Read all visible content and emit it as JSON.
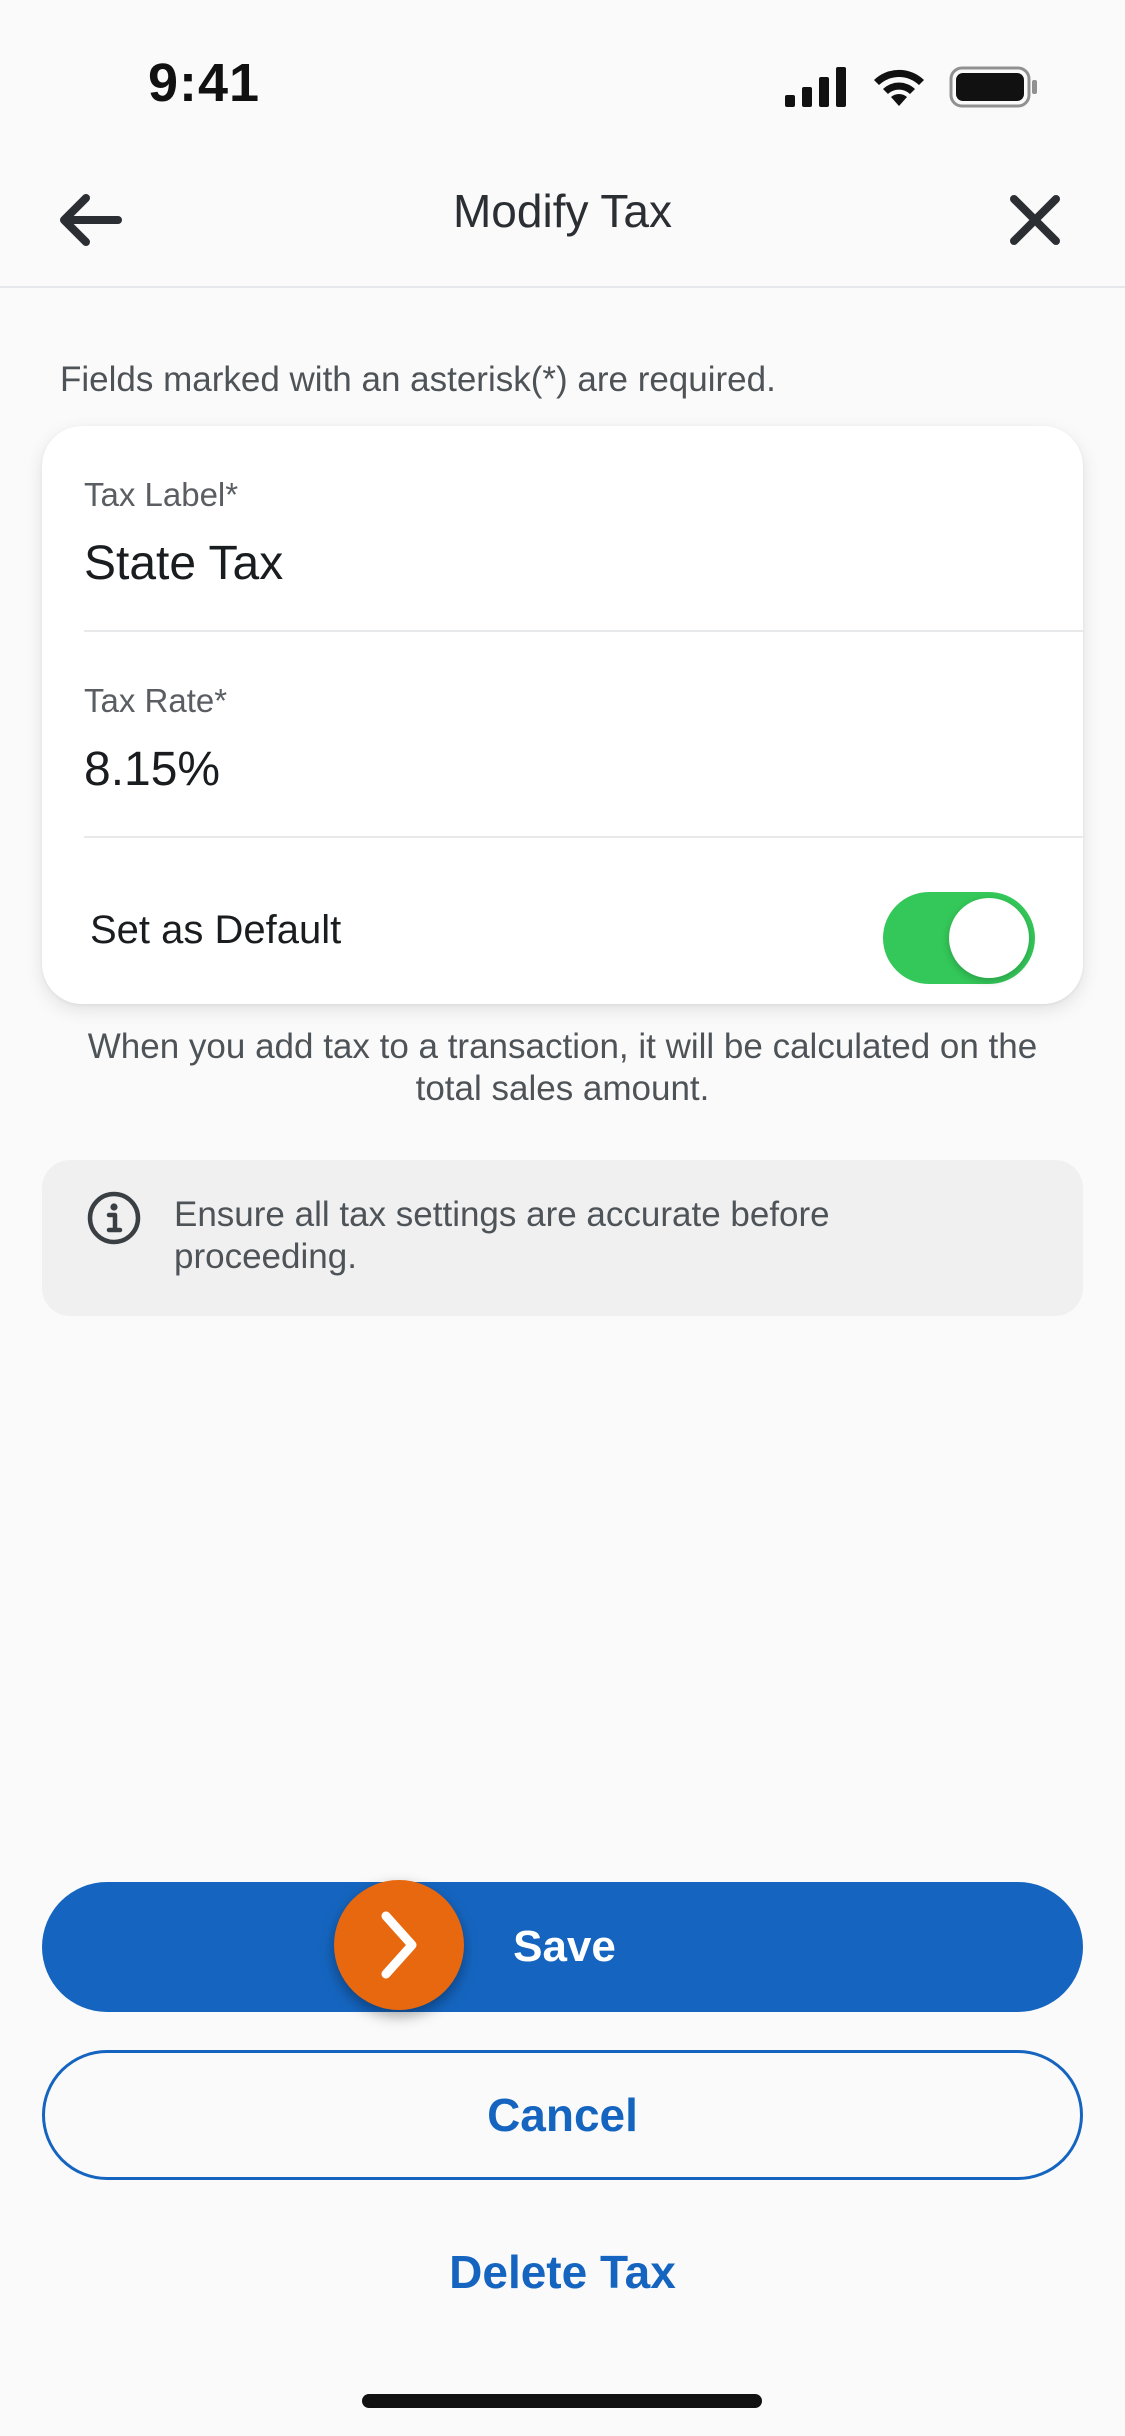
{
  "status_bar": {
    "time": "9:41"
  },
  "header": {
    "title": "Modify Tax",
    "back_icon": "arrow-left-icon",
    "close_icon": "close-icon"
  },
  "form": {
    "required_note": "Fields marked with an asterisk(*) are required.",
    "tax_label": {
      "label": "Tax Label*",
      "value": "State Tax"
    },
    "tax_rate": {
      "label": "Tax Rate*",
      "value": "8.15%"
    },
    "set_default": {
      "label": "Set as Default",
      "enabled": true
    }
  },
  "helper_text": "When you add tax to a transaction, it will be calculated on the total sales amount.",
  "info_box": {
    "icon": "info-icon",
    "text": "Ensure all tax settings are accurate before proceeding."
  },
  "actions": {
    "save_label": "Save",
    "cancel_label": "Cancel",
    "delete_label": "Delete Tax"
  },
  "colors": {
    "primary": "#1565c0",
    "toggle_on": "#34c759",
    "cursor_badge": "#e8680f",
    "background": "#fafafa"
  }
}
